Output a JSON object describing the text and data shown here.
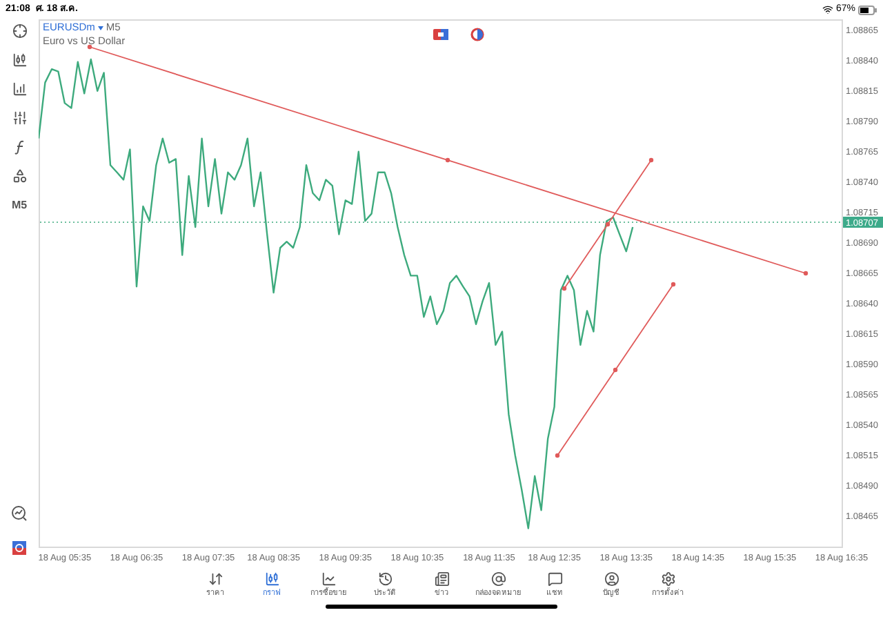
{
  "status_bar": {
    "time": "21:08",
    "date": "ศ. 18 ส.ค.",
    "battery": "67%"
  },
  "toolbar": {
    "timeframe": "M5"
  },
  "chart": {
    "symbol": "EURUSDm",
    "timeframe": "M5",
    "description": "Euro vs US Dollar",
    "chart_data": {
      "type": "line",
      "categories": [
        null,
        null,
        null,
        null,
        "18 Aug 05:35",
        null,
        null,
        null,
        null,
        null,
        null,
        null,
        null,
        null,
        null,
        "18 Aug 06:35",
        null,
        null,
        null,
        null,
        null,
        null,
        null,
        null,
        null,
        null,
        "18 Aug 07:35",
        null,
        null,
        null,
        null,
        null,
        null,
        null,
        null,
        null,
        "18 Aug 08:35",
        null,
        null,
        null,
        null,
        null,
        null,
        null,
        null,
        null,
        null,
        "18 Aug 09:35",
        null,
        null,
        null,
        null,
        null,
        null,
        null,
        null,
        null,
        null,
        "18 Aug 10:35",
        null,
        null,
        null,
        null,
        null,
        null,
        null,
        null,
        null,
        null,
        "18 Aug 11:35",
        null,
        null,
        null,
        null,
        null,
        null,
        null,
        null,
        null,
        "18 Aug 12:35",
        null,
        null,
        null,
        null,
        null,
        null,
        null,
        null,
        null,
        null,
        "18 Aug 13:35",
        null,
        null,
        null,
        null,
        null,
        null,
        null,
        null,
        null,
        null,
        "18 Aug 14:35",
        null,
        null,
        null,
        null,
        null,
        null,
        null,
        null,
        null,
        null,
        "18 Aug 15:35",
        null,
        null,
        null,
        null,
        null,
        null,
        null,
        null,
        null,
        null,
        "18 Aug 16:35"
      ],
      "ylim": [
        1.0844,
        1.08874
      ],
      "series": [
        {
          "color": "#3daa7d",
          "values": [
            1.08776,
            1.08822,
            1.08833,
            1.08831,
            1.08805,
            1.08801,
            1.08839,
            1.08813,
            1.08841,
            1.08815,
            1.0883,
            1.08754,
            1.08748,
            1.08742,
            1.08767,
            1.08654,
            1.0872,
            1.08708,
            1.08754,
            1.08776,
            1.08756,
            1.08759,
            1.0868,
            1.08745,
            1.08703,
            1.08776,
            1.0872,
            1.08759,
            1.08714,
            1.08748,
            1.08742,
            1.08754,
            1.08776,
            1.0872,
            1.08748,
            1.08697,
            1.08649,
            1.08686,
            1.08691,
            1.08686,
            1.08703,
            1.08754,
            1.08731,
            1.08725,
            1.08742,
            1.08737,
            1.08697,
            1.08725,
            1.08722,
            1.08765,
            1.08708,
            1.08714,
            1.08748,
            1.08748,
            1.08731,
            1.08703,
            1.0868,
            1.08663,
            1.08663,
            1.08629,
            1.08646,
            1.08623,
            1.08634,
            1.08657,
            1.08663,
            1.08654,
            1.08646,
            1.08623,
            1.08642,
            1.08657,
            1.08606,
            1.08617,
            1.08549,
            1.08515,
            1.08487,
            1.08455,
            1.08498,
            1.0847,
            1.08529,
            1.08555,
            1.08651,
            1.08663,
            1.08651,
            1.08606,
            1.08634,
            1.08617,
            1.0868,
            1.08708,
            1.08711,
            1.08697,
            1.08683,
            1.08703,
            null,
            null,
            null,
            null,
            null,
            null,
            null,
            null,
            null,
            null,
            null,
            null,
            null,
            null,
            null,
            null,
            null,
            null,
            null,
            null,
            null,
            null,
            null,
            null,
            null,
            null,
            null,
            null,
            null,
            null,
            null,
            null
          ]
        }
      ],
      "yticks": [
        {
          "value": 1.08865,
          "label": "1.08865"
        },
        {
          "value": 1.0884,
          "label": "1.08840"
        },
        {
          "value": 1.08815,
          "label": "1.08815"
        },
        {
          "value": 1.0879,
          "label": "1.08790"
        },
        {
          "value": 1.08765,
          "label": "1.08765"
        },
        {
          "value": 1.0874,
          "label": "1.08740"
        },
        {
          "value": 1.08715,
          "label": "1.08715"
        },
        {
          "value": 1.0869,
          "label": "1.08690"
        },
        {
          "value": 1.08665,
          "label": "1.08665"
        },
        {
          "value": 1.0864,
          "label": "1.08640"
        },
        {
          "value": 1.08615,
          "label": "1.08615"
        },
        {
          "value": 1.0859,
          "label": "1.08590"
        },
        {
          "value": 1.08565,
          "label": "1.08565"
        },
        {
          "value": 1.0854,
          "label": "1.08540"
        },
        {
          "value": 1.08515,
          "label": "1.08515"
        },
        {
          "value": 1.0849,
          "label": "1.08490"
        },
        {
          "value": 1.08465,
          "label": "1.08465"
        }
      ],
      "ref_lines": [
        {
          "axis": "y",
          "value": 1.08707,
          "label": "1.08707"
        }
      ]
    }
  },
  "bottom_nav": [
    {
      "label": "ราคา",
      "selected": false
    },
    {
      "label": "กราฟ",
      "selected": true
    },
    {
      "label": "การซื้อขาย",
      "selected": false
    },
    {
      "label": "ประวัติ",
      "selected": false
    },
    {
      "label": "ข่าว",
      "selected": false
    },
    {
      "label": "กล่องจดหมาย",
      "selected": false
    },
    {
      "label": "แชท",
      "selected": false
    },
    {
      "label": "บัญชี",
      "selected": false
    },
    {
      "label": "การตั้งค่า",
      "selected": false
    }
  ]
}
